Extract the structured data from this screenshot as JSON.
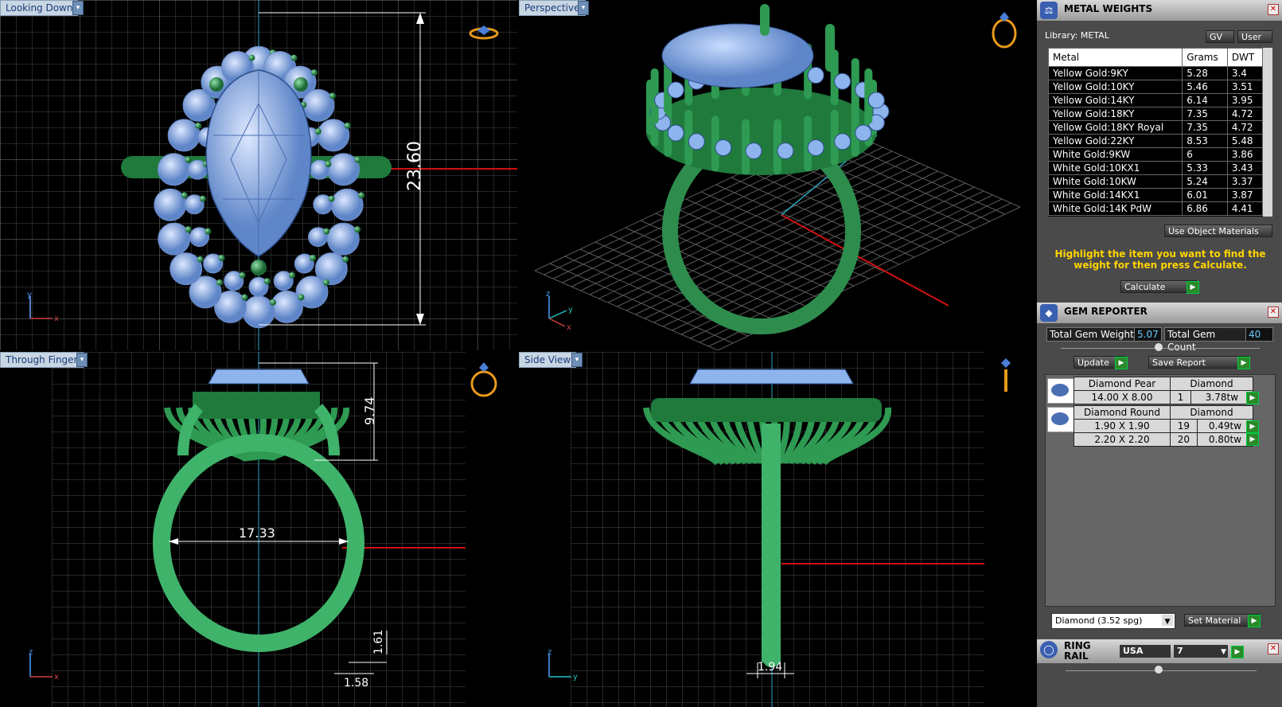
{
  "viewports": {
    "top_left": {
      "label": "Looking Down",
      "dim": "23.60",
      "axis1": "y",
      "axis2": "x"
    },
    "top_right": {
      "label": "Perspective",
      "axis_z": "z",
      "axis_y": "y",
      "axis_x": "x"
    },
    "bottom_left": {
      "label": "Through Finger",
      "dim_height": "9.74",
      "dim_width": "17.33",
      "dim_shank": "1.61",
      "dim_band": "1.58",
      "axis1": "z",
      "axis2": "x"
    },
    "bottom_right": {
      "label": "Side View",
      "dim_band": "1.94",
      "axis1": "z",
      "axis2": "y"
    }
  },
  "metal_weights": {
    "title": "METAL WEIGHTS",
    "library": "Library: METAL",
    "gv_label": "GV",
    "user_label": "User",
    "columns": [
      "Metal",
      "Grams",
      "DWT"
    ],
    "rows": [
      [
        "Yellow Gold:9KY",
        "5.28",
        "3.4"
      ],
      [
        "Yellow Gold:10KY",
        "5.46",
        "3.51"
      ],
      [
        "Yellow Gold:14KY",
        "6.14",
        "3.95"
      ],
      [
        "Yellow Gold:18KY",
        "7.35",
        "4.72"
      ],
      [
        "Yellow Gold:18KY Royal",
        "7.35",
        "4.72"
      ],
      [
        "Yellow Gold:22KY",
        "8.53",
        "5.48"
      ],
      [
        "White Gold:9KW",
        "6",
        "3.86"
      ],
      [
        "White Gold:10KX1",
        "5.33",
        "3.43"
      ],
      [
        "White Gold:10KW",
        "5.24",
        "3.37"
      ],
      [
        "White Gold:14KX1",
        "6.01",
        "3.87"
      ],
      [
        "White Gold:14K PdW",
        "6.86",
        "4.41"
      ]
    ],
    "use_object_materials": "Use Object Materials",
    "highlight_text": "Highlight the item you want to find the weight for then press Calculate.",
    "calculate_label": "Calculate"
  },
  "gem_reporter": {
    "title": "GEM REPORTER",
    "total_weight_label": "Total Gem Weight",
    "total_weight_value": "5.07",
    "total_count_label": "Total Gem Count",
    "total_count_value": "40",
    "update_label": "Update",
    "save_report_label": "Save Report",
    "groups": [
      {
        "name": "Diamond Pear",
        "material": "Diamond",
        "rows": [
          [
            "14.00 X 8.00",
            "1",
            "3.78tw"
          ]
        ]
      },
      {
        "name": "Diamond Round",
        "material": "Diamond",
        "rows": [
          [
            "1.90 X 1.90",
            "19",
            "0.49tw"
          ],
          [
            "2.20 X 2.20",
            "20",
            "0.80tw"
          ]
        ]
      }
    ],
    "material_select": "Diamond    (3.52 spg)",
    "set_material_label": "Set Material"
  },
  "ring_rail": {
    "title": "RING RAIL",
    "region": "USA",
    "size": "7"
  },
  "colors": {
    "grid": "#4b4b4b",
    "metal": "#3a9a5a",
    "gem": "#8eb4ee",
    "accent": "#ffd400"
  }
}
